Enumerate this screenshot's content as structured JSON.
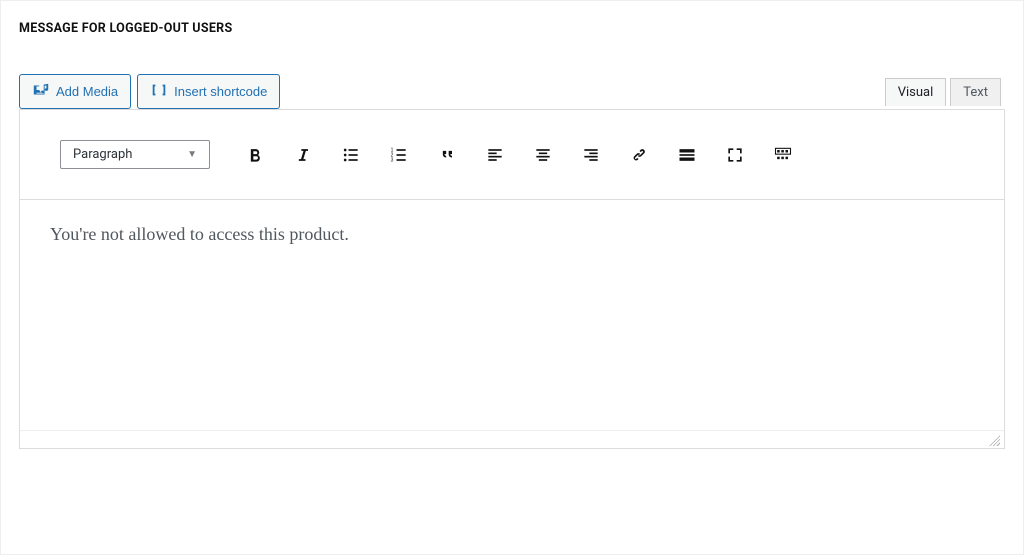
{
  "section": {
    "title": "MESSAGE FOR LOGGED-OUT USERS"
  },
  "buttons": {
    "add_media": "Add Media",
    "insert_shortcode": "Insert shortcode"
  },
  "tabs": {
    "visual": "Visual",
    "text": "Text"
  },
  "toolbar": {
    "format_select": "Paragraph"
  },
  "editor": {
    "content": "You're not allowed to access this product."
  }
}
